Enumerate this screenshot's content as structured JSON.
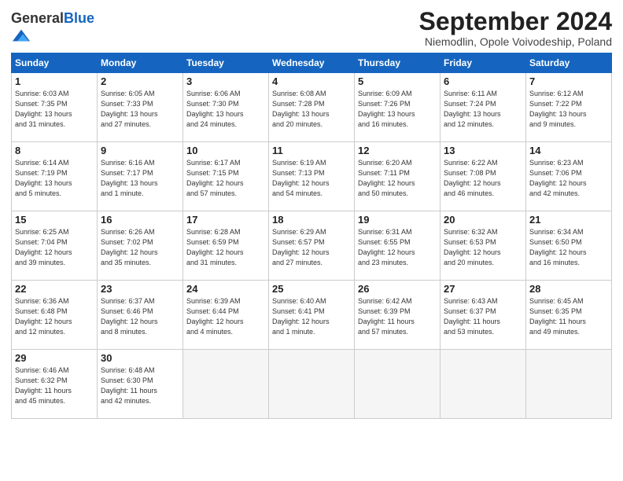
{
  "header": {
    "logo_general": "General",
    "logo_blue": "Blue",
    "month_title": "September 2024",
    "location": "Niemodlin, Opole Voivodeship, Poland"
  },
  "days_of_week": [
    "Sunday",
    "Monday",
    "Tuesday",
    "Wednesday",
    "Thursday",
    "Friday",
    "Saturday"
  ],
  "weeks": [
    [
      {
        "day": "1",
        "info": "Sunrise: 6:03 AM\nSunset: 7:35 PM\nDaylight: 13 hours\nand 31 minutes."
      },
      {
        "day": "2",
        "info": "Sunrise: 6:05 AM\nSunset: 7:33 PM\nDaylight: 13 hours\nand 27 minutes."
      },
      {
        "day": "3",
        "info": "Sunrise: 6:06 AM\nSunset: 7:30 PM\nDaylight: 13 hours\nand 24 minutes."
      },
      {
        "day": "4",
        "info": "Sunrise: 6:08 AM\nSunset: 7:28 PM\nDaylight: 13 hours\nand 20 minutes."
      },
      {
        "day": "5",
        "info": "Sunrise: 6:09 AM\nSunset: 7:26 PM\nDaylight: 13 hours\nand 16 minutes."
      },
      {
        "day": "6",
        "info": "Sunrise: 6:11 AM\nSunset: 7:24 PM\nDaylight: 13 hours\nand 12 minutes."
      },
      {
        "day": "7",
        "info": "Sunrise: 6:12 AM\nSunset: 7:22 PM\nDaylight: 13 hours\nand 9 minutes."
      }
    ],
    [
      {
        "day": "8",
        "info": "Sunrise: 6:14 AM\nSunset: 7:19 PM\nDaylight: 13 hours\nand 5 minutes."
      },
      {
        "day": "9",
        "info": "Sunrise: 6:16 AM\nSunset: 7:17 PM\nDaylight: 13 hours\nand 1 minute."
      },
      {
        "day": "10",
        "info": "Sunrise: 6:17 AM\nSunset: 7:15 PM\nDaylight: 12 hours\nand 57 minutes."
      },
      {
        "day": "11",
        "info": "Sunrise: 6:19 AM\nSunset: 7:13 PM\nDaylight: 12 hours\nand 54 minutes."
      },
      {
        "day": "12",
        "info": "Sunrise: 6:20 AM\nSunset: 7:11 PM\nDaylight: 12 hours\nand 50 minutes."
      },
      {
        "day": "13",
        "info": "Sunrise: 6:22 AM\nSunset: 7:08 PM\nDaylight: 12 hours\nand 46 minutes."
      },
      {
        "day": "14",
        "info": "Sunrise: 6:23 AM\nSunset: 7:06 PM\nDaylight: 12 hours\nand 42 minutes."
      }
    ],
    [
      {
        "day": "15",
        "info": "Sunrise: 6:25 AM\nSunset: 7:04 PM\nDaylight: 12 hours\nand 39 minutes."
      },
      {
        "day": "16",
        "info": "Sunrise: 6:26 AM\nSunset: 7:02 PM\nDaylight: 12 hours\nand 35 minutes."
      },
      {
        "day": "17",
        "info": "Sunrise: 6:28 AM\nSunset: 6:59 PM\nDaylight: 12 hours\nand 31 minutes."
      },
      {
        "day": "18",
        "info": "Sunrise: 6:29 AM\nSunset: 6:57 PM\nDaylight: 12 hours\nand 27 minutes."
      },
      {
        "day": "19",
        "info": "Sunrise: 6:31 AM\nSunset: 6:55 PM\nDaylight: 12 hours\nand 23 minutes."
      },
      {
        "day": "20",
        "info": "Sunrise: 6:32 AM\nSunset: 6:53 PM\nDaylight: 12 hours\nand 20 minutes."
      },
      {
        "day": "21",
        "info": "Sunrise: 6:34 AM\nSunset: 6:50 PM\nDaylight: 12 hours\nand 16 minutes."
      }
    ],
    [
      {
        "day": "22",
        "info": "Sunrise: 6:36 AM\nSunset: 6:48 PM\nDaylight: 12 hours\nand 12 minutes."
      },
      {
        "day": "23",
        "info": "Sunrise: 6:37 AM\nSunset: 6:46 PM\nDaylight: 12 hours\nand 8 minutes."
      },
      {
        "day": "24",
        "info": "Sunrise: 6:39 AM\nSunset: 6:44 PM\nDaylight: 12 hours\nand 4 minutes."
      },
      {
        "day": "25",
        "info": "Sunrise: 6:40 AM\nSunset: 6:41 PM\nDaylight: 12 hours\nand 1 minute."
      },
      {
        "day": "26",
        "info": "Sunrise: 6:42 AM\nSunset: 6:39 PM\nDaylight: 11 hours\nand 57 minutes."
      },
      {
        "day": "27",
        "info": "Sunrise: 6:43 AM\nSunset: 6:37 PM\nDaylight: 11 hours\nand 53 minutes."
      },
      {
        "day": "28",
        "info": "Sunrise: 6:45 AM\nSunset: 6:35 PM\nDaylight: 11 hours\nand 49 minutes."
      }
    ],
    [
      {
        "day": "29",
        "info": "Sunrise: 6:46 AM\nSunset: 6:32 PM\nDaylight: 11 hours\nand 45 minutes."
      },
      {
        "day": "30",
        "info": "Sunrise: 6:48 AM\nSunset: 6:30 PM\nDaylight: 11 hours\nand 42 minutes."
      },
      {
        "day": "",
        "info": ""
      },
      {
        "day": "",
        "info": ""
      },
      {
        "day": "",
        "info": ""
      },
      {
        "day": "",
        "info": ""
      },
      {
        "day": "",
        "info": ""
      }
    ]
  ]
}
